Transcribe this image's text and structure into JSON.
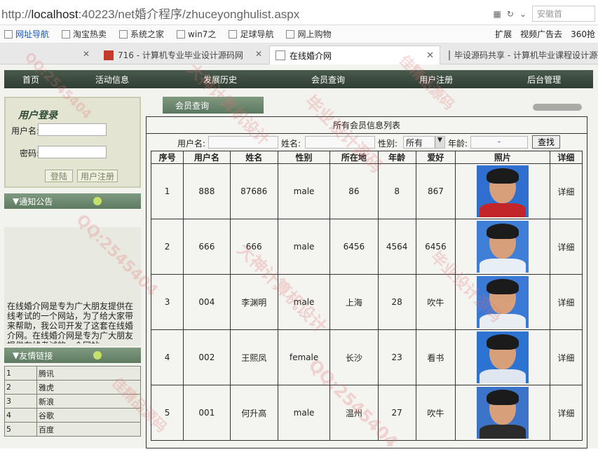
{
  "browser": {
    "url_prefix": "http://",
    "url_host": "localhost",
    "url_rest": ":40223/net婚介程序/zhuceyonghulist.aspx",
    "search_text": "安徽首",
    "bookmarks": [
      "网址导航",
      "淘宝热卖",
      "系统之家",
      "win7之",
      "足球导航",
      "网上购物"
    ],
    "bookmarks_right": [
      "扩展",
      "视频广告去",
      "360抢"
    ],
    "tabs": [
      {
        "title": "716 - 计算机专业毕业设计源码网"
      },
      {
        "title": "在线婚介网"
      },
      {
        "title": "毕设源码共享 - 计算机毕业课程设计源码"
      }
    ]
  },
  "nav": {
    "items": [
      "首页",
      "活动信息",
      "发展历史",
      "会员查询",
      "用户注册",
      "后台管理"
    ]
  },
  "login": {
    "title": "用户登录",
    "username_label": "用户名:",
    "password_label": "密码:",
    "login_button": "登陆",
    "register_button": "用户注册"
  },
  "notice": {
    "title": "通知公告",
    "text": "在线婚介网是专为广大朋友提供在线考试的一个网站，为了给大家带来帮助，我公司开发了这套在线婚介网。在线婚介网是专为广大朋友提供在线考试的一个网站"
  },
  "friend_links": {
    "title": "友情链接",
    "rows": [
      {
        "no": "1",
        "name": "腾讯"
      },
      {
        "no": "2",
        "name": "雅虎"
      },
      {
        "no": "3",
        "name": "新浪"
      },
      {
        "no": "4",
        "name": "谷歌"
      },
      {
        "no": "5",
        "name": "百度"
      }
    ]
  },
  "member": {
    "head": "会员查询",
    "list_title": "所有会员信息列表",
    "filter_username": "用户名:",
    "filter_name": "姓名:",
    "filter_gender": "性别:",
    "gender_value": "所有",
    "filter_age": "年龄:",
    "age_sep": "-",
    "search_button": "查找",
    "columns": [
      "序号",
      "用户名",
      "姓名",
      "性别",
      "所在地",
      "年龄",
      "爱好",
      "照片",
      "详细"
    ],
    "rows": [
      {
        "no": "1",
        "username": "888",
        "name": "87686",
        "gender": "male",
        "place": "86",
        "age": "8",
        "hobby": "867",
        "detail": "详细",
        "photo_bg": "#2f6fcf",
        "shirt": "#c3262a"
      },
      {
        "no": "2",
        "username": "666",
        "name": "666",
        "gender": "male",
        "place": "6456",
        "age": "4564",
        "hobby": "6456",
        "detail": "详细",
        "photo_bg": "#3f7fd8",
        "shirt": "#e8eef5"
      },
      {
        "no": "3",
        "username": "004",
        "name": "李渊明",
        "gender": "male",
        "place": "上海",
        "age": "28",
        "hobby": "吹牛",
        "detail": "详细",
        "photo_bg": "#3a79d6",
        "shirt": "#e9eef3"
      },
      {
        "no": "4",
        "username": "002",
        "name": "王熙凤",
        "gender": "female",
        "place": "长沙",
        "age": "23",
        "hobby": "看书",
        "detail": "详细",
        "photo_bg": "#2d73d2",
        "shirt": "#dfe6ef"
      },
      {
        "no": "5",
        "username": "001",
        "name": "何升高",
        "gender": "male",
        "place": "温州",
        "age": "27",
        "hobby": "吹牛",
        "detail": "详细",
        "photo_bg": "#3b74c8",
        "shirt": "#2b2b2b"
      }
    ]
  },
  "watermark": {
    "texts": [
      "QQ:2545404",
      "大神计算机设计",
      "毕业设计源码",
      "佳精品源码"
    ]
  }
}
